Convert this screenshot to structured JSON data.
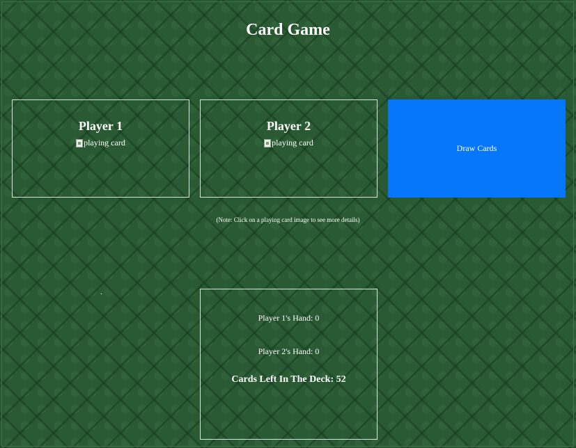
{
  "page": {
    "title": "Card Game"
  },
  "players": [
    {
      "name": "Player 1",
      "card_alt": "playing card"
    },
    {
      "name": "Player 2",
      "card_alt": "playing card"
    }
  ],
  "controls": {
    "draw_label": "Draw Cards",
    "draw_color": "#0677fb"
  },
  "note": "(Note: Click on a playing card image to see more details)",
  "marker": ".",
  "stats": {
    "p1_prefix": "Player 1's Hand: ",
    "p1_count": "0",
    "p2_prefix": "Player 2's Hand: ",
    "p2_count": "0",
    "deck_prefix": "Cards Left In The Deck: ",
    "deck_count": "52"
  },
  "theme": {
    "felt_color": "#2a5a33",
    "text_color": "#ffffff"
  }
}
